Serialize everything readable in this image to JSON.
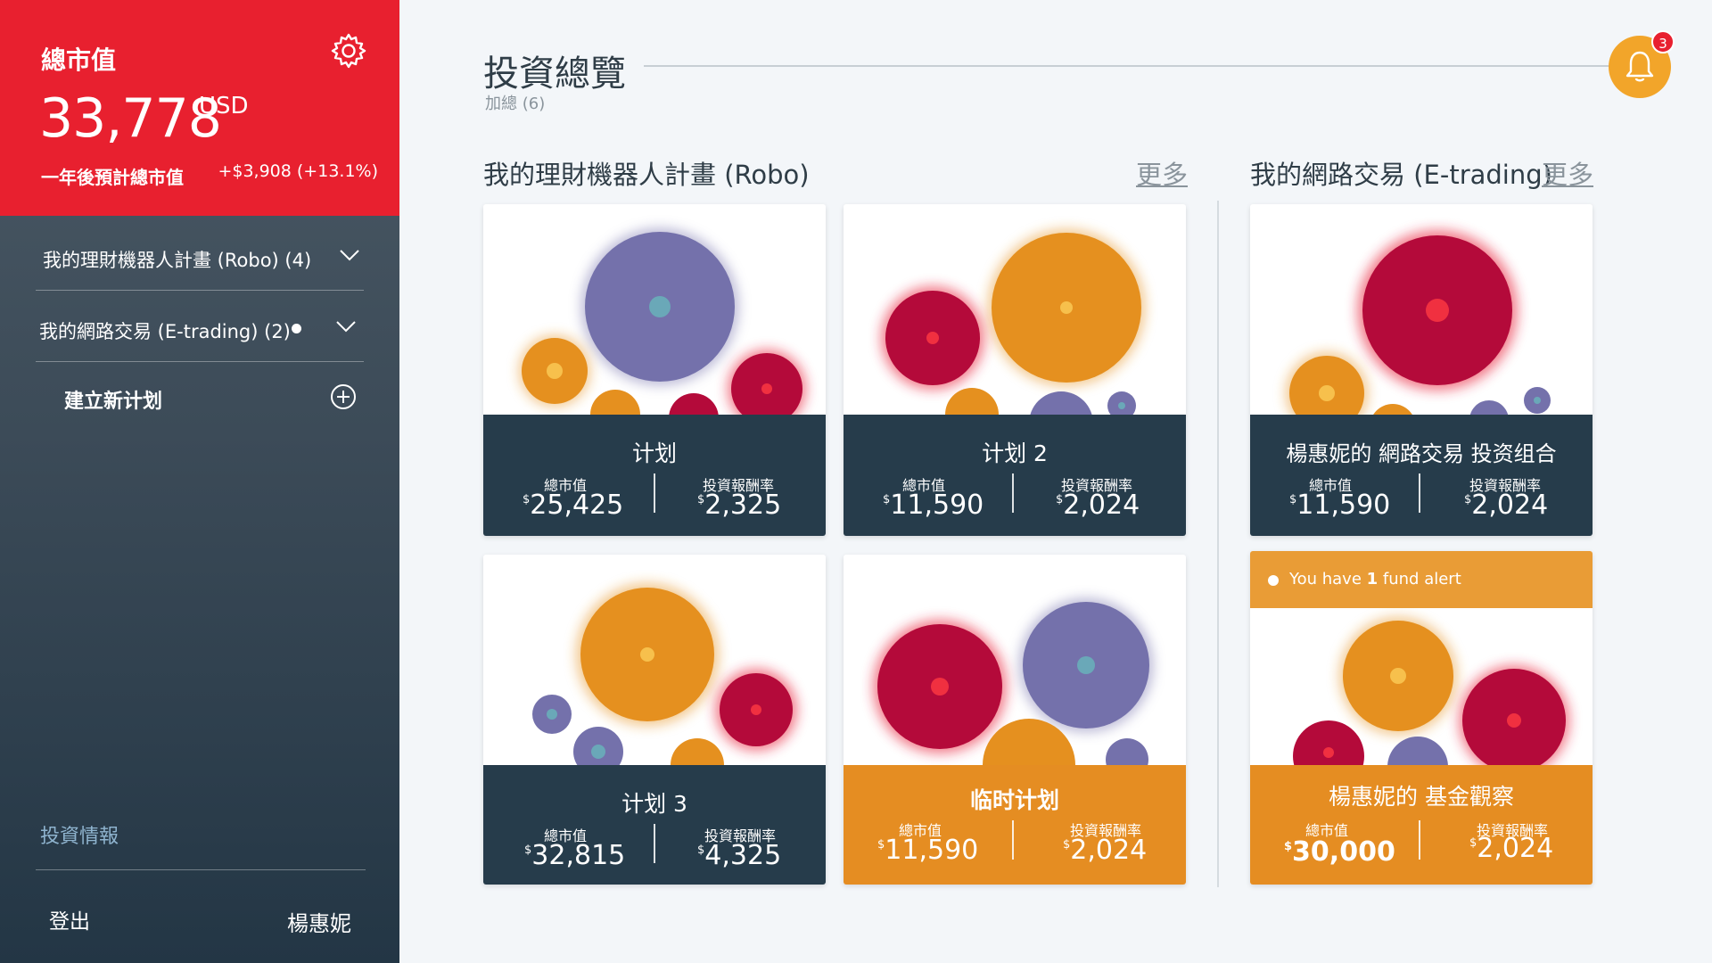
{
  "sidebar": {
    "hero": {
      "title": "總市值",
      "value": "33,778",
      "currency": "USD",
      "projection_label": "一年後預計總市值",
      "projection_value": "+$3,908 (+13.1%)"
    },
    "nav": [
      {
        "label": "我的理財機器人計畫 (Robo) (4)"
      },
      {
        "label": "我的網路交易 (E-trading) (2)"
      }
    ],
    "create_label": "建立新计划",
    "info_label": "投資情報",
    "logout_label": "登出",
    "username": "楊惠妮"
  },
  "header": {
    "title": "投資總覽",
    "subtitle": "加總 (6)",
    "notification_count": "3"
  },
  "sections": {
    "robo": {
      "title": "我的理財機器人計畫 (Robo)",
      "more": "更多"
    },
    "etrading": {
      "title": "我的網路交易 (E-trading)",
      "more": "更多"
    }
  },
  "cards": [
    {
      "name": "计划",
      "label_value": "總市值",
      "value": "25,425",
      "label_return": "投資報酬率",
      "return": "2,325",
      "currency_symbol": "$"
    },
    {
      "name": "计划 2",
      "label_value": "總市值",
      "value": "11,590",
      "label_return": "投資報酬率",
      "return": "2,024",
      "currency_symbol": "$"
    },
    {
      "name": "楊惠妮的 網路交易 投资组合",
      "label_value": "總市值",
      "value": "11,590",
      "label_return": "投資報酬率",
      "return": "2,024",
      "currency_symbol": "$"
    },
    {
      "name": "计划 3",
      "label_value": "總市值",
      "value": "32,815",
      "label_return": "投資報酬率",
      "return": "4,325",
      "currency_symbol": "$"
    },
    {
      "name": "临时计划",
      "label_value": "總市值",
      "value": "11,590",
      "label_return": "投資報酬率",
      "return": "2,024",
      "currency_symbol": "$"
    },
    {
      "name": "楊惠妮的 基金觀察",
      "label_value": "總市值",
      "value": "30,000",
      "label_return": "投資報酬率",
      "return": "2,024",
      "currency_symbol": "$"
    }
  ],
  "alert": {
    "prefix": "You have ",
    "count": "1",
    "suffix": " fund alert"
  },
  "colors": {
    "brand_red": "#e8202f",
    "navy": "#263c4b",
    "orange": "#e58d22",
    "bubble_purple": "#7471ab",
    "bubble_orange": "#e5901f",
    "bubble_red": "#b40a3a",
    "bell": "#f2a52a"
  },
  "icons": [
    "gear-icon",
    "chevron-down-icon",
    "plus-circle-icon",
    "bell-icon",
    "info-icon"
  ]
}
